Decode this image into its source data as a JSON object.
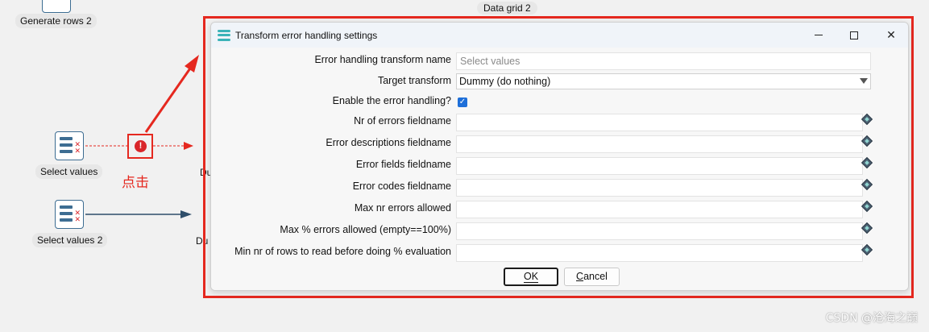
{
  "canvas": {
    "nodes": [
      {
        "label": "Generate rows 2"
      },
      {
        "label": "Select values"
      },
      {
        "label": "Select values 2"
      }
    ],
    "truncated_labels": [
      "Du",
      "Du"
    ],
    "data_grid_title": "Data grid 2",
    "error_icon": "!",
    "annotation": "点击",
    "watermark": "CSDN @沧海之巅"
  },
  "colors": {
    "highlight": "#e5281f",
    "checkbox": "#1e6fd9",
    "hop": "#2f4e6a"
  },
  "dialog": {
    "title": "Transform error handling settings",
    "title_icon": "layers-icon",
    "window_controls": [
      "minimize-icon",
      "maximize-icon",
      "close-icon"
    ],
    "close_glyph": "✕",
    "fields": {
      "transform_name": {
        "label": "Error handling transform name",
        "placeholder": "Select values",
        "value": ""
      },
      "target_transform": {
        "label": "Target transform",
        "value": "Dummy (do nothing)"
      },
      "enable_error_handling": {
        "label": "Enable the error handling?",
        "checked": true,
        "glyph": "✓"
      },
      "nr_errors_fieldname": {
        "label": "Nr of errors fieldname",
        "value": ""
      },
      "error_descriptions_fieldname": {
        "label": "Error descriptions fieldname",
        "value": ""
      },
      "error_fields_fieldname": {
        "label": "Error fields fieldname",
        "value": ""
      },
      "error_codes_fieldname": {
        "label": "Error codes fieldname",
        "value": ""
      },
      "max_nr_errors": {
        "label": "Max nr errors allowed",
        "value": ""
      },
      "max_pct_errors": {
        "label": "Max % errors allowed (empty==100%)",
        "value": ""
      },
      "min_rows_before_eval": {
        "label": "Min nr of rows to read before doing % evaluation",
        "value": ""
      }
    },
    "buttons": {
      "ok_label": "OK",
      "cancel_label_first": "C",
      "cancel_label_rest": "ancel"
    }
  }
}
